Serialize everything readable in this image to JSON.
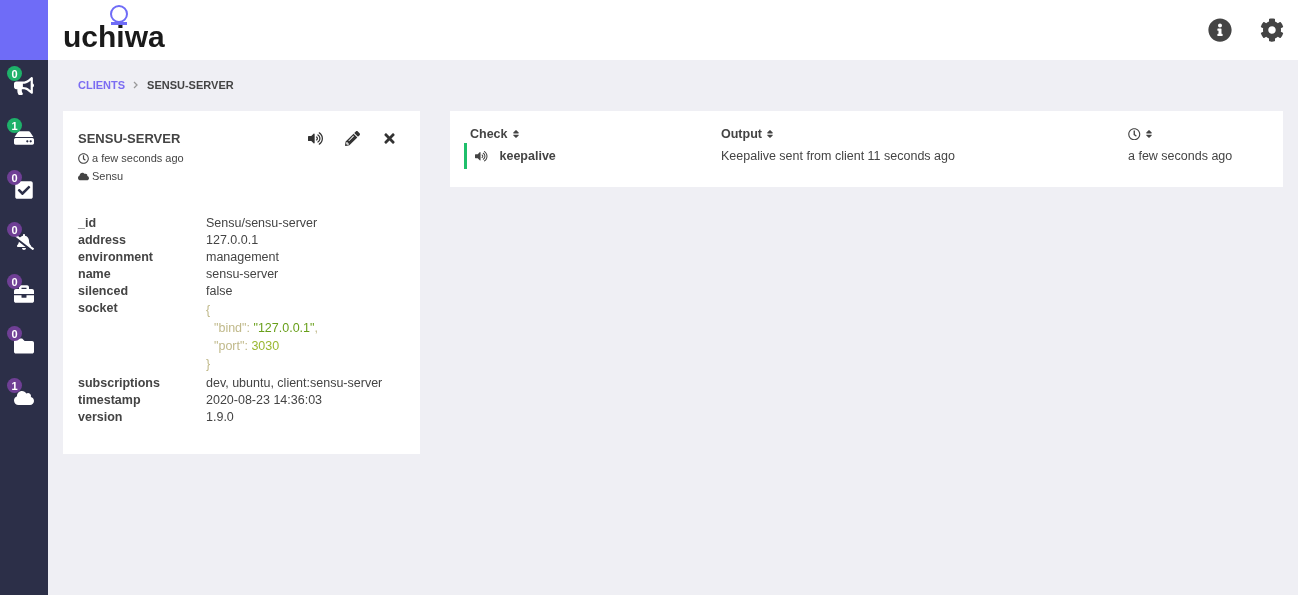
{
  "logo": {
    "text": "uchiwa"
  },
  "sidebar": {
    "items": [
      {
        "badge": "0",
        "color": "#1eb16a",
        "selected": false
      },
      {
        "badge": "1",
        "color": "#1eb16a",
        "selected": false
      },
      {
        "badge": "0",
        "color": "#6f3f95",
        "selected": false
      },
      {
        "badge": "0",
        "color": "#6f3f95",
        "selected": false
      },
      {
        "badge": "0",
        "color": "#6f3f95",
        "selected": false
      },
      {
        "badge": "0",
        "color": "#6f3f95",
        "selected": false
      },
      {
        "badge": "1",
        "color": "#6f3f95",
        "selected": false
      }
    ]
  },
  "breadcrumb": [
    {
      "label": "CLIENTS",
      "kind": "link"
    },
    {
      "label": "SENSU-SERVER",
      "kind": "current"
    }
  ],
  "client": {
    "name": "SENSU-SERVER",
    "time": "a few seconds ago",
    "datacenter": "Sensu",
    "attributes": [
      {
        "key": "_id",
        "kind": "text",
        "value": "Sensu/sensu-server"
      },
      {
        "key": "address",
        "kind": "text",
        "value": "127.0.0.1"
      },
      {
        "key": "environment",
        "kind": "text",
        "value": "management"
      },
      {
        "key": "name",
        "kind": "text",
        "value": "sensu-server"
      },
      {
        "key": "silenced",
        "kind": "text",
        "value": "false"
      },
      {
        "key": "socket",
        "kind": "object",
        "open": "{",
        "close": "}",
        "fields": [
          {
            "key": "\"bind\":",
            "value": "\"127.0.0.1\"",
            "kind": "string",
            "trailing": ","
          },
          {
            "key": "\"port\":",
            "value": "3030",
            "kind": "number"
          }
        ]
      },
      {
        "key": "subscriptions",
        "kind": "text",
        "value": "dev, ubuntu, client:sensu-server"
      },
      {
        "key": "timestamp",
        "kind": "text",
        "value": "2020-08-23 14:36:03"
      },
      {
        "key": "version",
        "kind": "text",
        "value": "1.9.0"
      }
    ]
  },
  "checks": {
    "columns": [
      {
        "label": "Check",
        "kind": "text"
      },
      {
        "label": "Output",
        "kind": "text"
      },
      {
        "kind": "clock"
      }
    ],
    "rows": [
      {
        "check": "keepalive",
        "output": "Keepalive sent from client 11 seconds ago",
        "time": "a few seconds ago",
        "color": "#1fbf6b"
      }
    ]
  }
}
